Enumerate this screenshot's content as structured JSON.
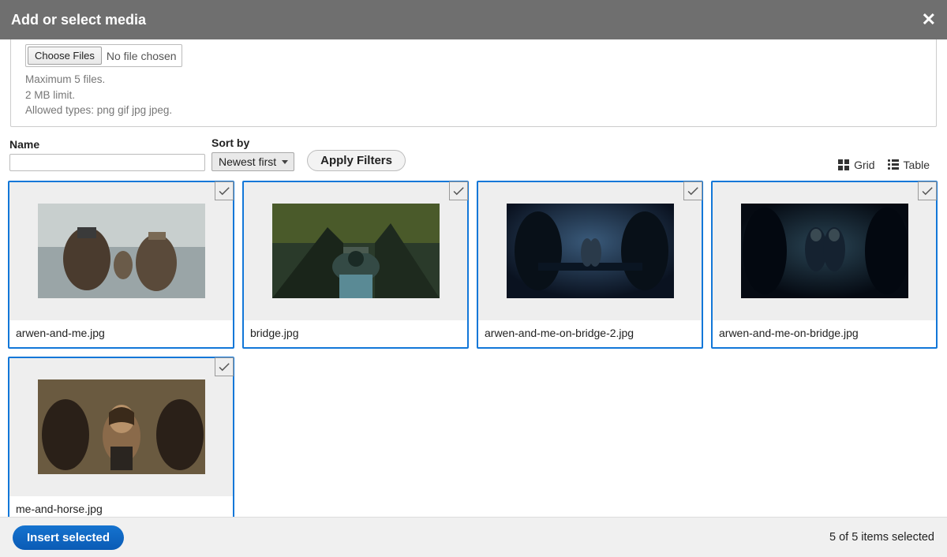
{
  "header": {
    "title": "Add or select media",
    "close": "✕"
  },
  "upload": {
    "choose_label": "Choose Files",
    "no_file": "No file chosen",
    "hint1": "Maximum 5 files.",
    "hint2": "2 MB limit.",
    "hint3": "Allowed types: png gif jpg jpeg."
  },
  "filters": {
    "name_label": "Name",
    "name_value": "",
    "sort_label": "Sort by",
    "sort_value": "Newest first",
    "apply": "Apply Filters"
  },
  "view": {
    "grid": "Grid",
    "table": "Table"
  },
  "items": [
    {
      "name": "arwen-and-me.jpg"
    },
    {
      "name": "bridge.jpg"
    },
    {
      "name": "arwen-and-me-on-bridge-2.jpg"
    },
    {
      "name": "arwen-and-me-on-bridge.jpg"
    },
    {
      "name": "me-and-horse.jpg"
    }
  ],
  "footer": {
    "insert": "Insert selected",
    "count": "5 of 5 items selected"
  }
}
